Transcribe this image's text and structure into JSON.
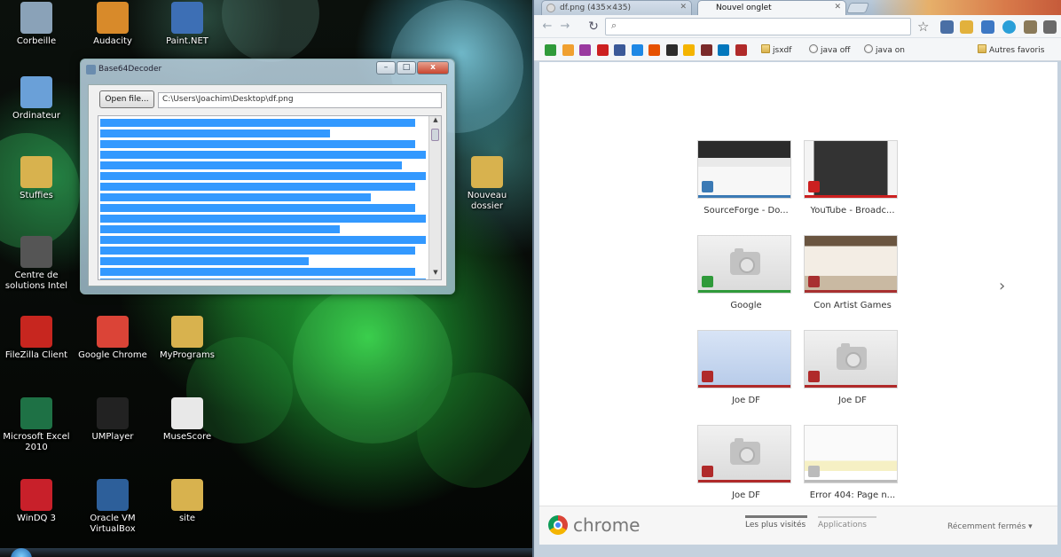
{
  "desktop": {
    "icons": [
      {
        "label": "Corbeille",
        "icon": "recycle-bin-icon",
        "color": "#8aa2b8"
      },
      {
        "label": "Audacity",
        "icon": "audacity-icon",
        "color": "#d88a2a"
      },
      {
        "label": "Paint.NET",
        "icon": "paintnet-icon",
        "color": "#3d6fb5"
      },
      {
        "label": "Ordinateur",
        "icon": "computer-icon",
        "color": "#6aa0d8"
      },
      {
        "label": "Stuffies",
        "icon": "folder-icon",
        "color": "#d8b24e"
      },
      {
        "label": "Centre de solutions Intel",
        "icon": "intel-center-icon",
        "color": "#555555"
      },
      {
        "label": "Nouveau dossier",
        "icon": "folder-icon",
        "color": "#d8b24e"
      },
      {
        "label": "FileZilla Client",
        "icon": "filezilla-icon",
        "color": "#c7261f"
      },
      {
        "label": "Google Chrome",
        "icon": "chrome-icon",
        "color": "#db4437"
      },
      {
        "label": "MyPrograms",
        "icon": "folder-icon",
        "color": "#d8b24e"
      },
      {
        "label": "Microsoft Excel 2010",
        "icon": "excel-icon",
        "color": "#1e7145"
      },
      {
        "label": "UMPlayer",
        "icon": "umplayer-icon",
        "color": "#222222"
      },
      {
        "label": "MuseScore",
        "icon": "musescore-icon",
        "color": "#e8e8e8"
      },
      {
        "label": "WinDQ 3",
        "icon": "windq-icon",
        "color": "#c8202a"
      },
      {
        "label": "Oracle VM VirtualBox",
        "icon": "virtualbox-icon",
        "color": "#2d5f9a"
      },
      {
        "label": "site",
        "icon": "folder-icon",
        "color": "#d8b24e"
      }
    ]
  },
  "b64_window": {
    "title": "Base64Decoder",
    "open_file_label": "Open file...",
    "file_path": "C:\\Users\\Joachim\\Desktop\\df.png",
    "minimize": "–",
    "maximize": "□",
    "close": "x",
    "selected_lines": 24
  },
  "chrome": {
    "tabs": [
      {
        "label": "df.png (435×435)",
        "active": false
      },
      {
        "label": "Nouvel onglet",
        "active": true
      }
    ],
    "omnibox": {
      "value": "",
      "placeholder": ""
    },
    "bookmarks": [
      {
        "type": "folder",
        "label": "jsxdf"
      },
      {
        "type": "globe",
        "label": "java off"
      },
      {
        "type": "globe",
        "label": "java on"
      }
    ],
    "bookmark_icon_colors": [
      "#2f9a3a",
      "#f0a030",
      "#9a3aa0",
      "#cc2020",
      "#3b5998",
      "#1e88e5",
      "#e65100",
      "#2c2c2c",
      "#f4b400",
      "#7a2a2a",
      "#0277bd",
      "#b02a2a"
    ],
    "other_bookmarks": "Autres favoris",
    "most_visited": [
      {
        "label": "SourceForge - Do...",
        "bar": "#3b7ab5",
        "fav": "#3b7ab5",
        "style": "sourceforge"
      },
      {
        "label": "YouTube - Broadc...",
        "bar": "#cc2020",
        "fav": "#cc2020",
        "style": "youtube"
      },
      {
        "label": "Google",
        "bar": "#2f9a3a",
        "fav": "#2f9a3a",
        "style": "blank"
      },
      {
        "label": "Con Artist Games",
        "bar": "#a83030",
        "fav": "#a83030",
        "style": "conartist"
      },
      {
        "label": "Joe DF",
        "bar": "#b02a2a",
        "fav": "#b02a2a",
        "style": "joedf"
      },
      {
        "label": "Joe DF",
        "bar": "#b02a2a",
        "fav": "#b02a2a",
        "style": "blank"
      },
      {
        "label": "Joe DF",
        "bar": "#b02a2a",
        "fav": "#b02a2a",
        "style": "blank"
      },
      {
        "label": "Error 404: Page n...",
        "bar": "#bbbbbb",
        "fav": "#bbbbbb",
        "style": "error"
      }
    ],
    "footer": {
      "brand": "chrome",
      "most_visited_tab": "Les plus visités",
      "apps_tab": "Applications",
      "recently_closed": "Récemment fermés ▾"
    }
  }
}
